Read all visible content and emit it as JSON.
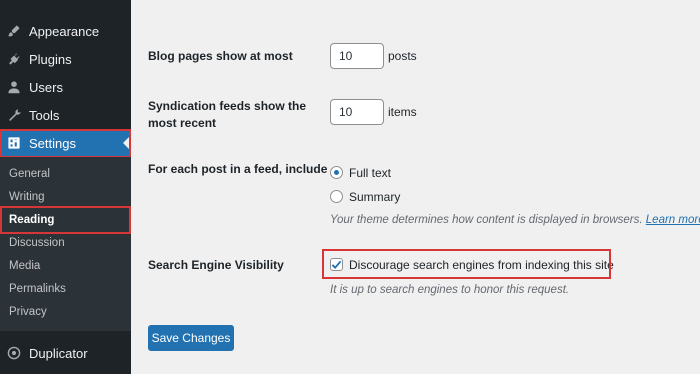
{
  "sidebar": {
    "menu": [
      {
        "label": "Appearance",
        "icon": "paintbrush-icon"
      },
      {
        "label": "Plugins",
        "icon": "plugin-icon"
      },
      {
        "label": "Users",
        "icon": "user-icon"
      },
      {
        "label": "Tools",
        "icon": "wrench-icon"
      },
      {
        "label": "Settings",
        "icon": "settings-icon"
      }
    ],
    "submenu": [
      "General",
      "Writing",
      "Reading",
      "Discussion",
      "Media",
      "Permalinks",
      "Privacy"
    ],
    "current_submenu": "Reading",
    "extra": {
      "label": "Duplicator",
      "icon": "duplicator-icon"
    }
  },
  "reading": {
    "blog_pages_label": "Blog pages show at most",
    "blog_pages_value": "10",
    "blog_pages_unit": "posts",
    "feeds_label_line1": "Syndication feeds show the",
    "feeds_label_line2": "most recent",
    "feeds_value": "10",
    "feeds_unit": "items",
    "feed_include_label": "For each post in a feed, include",
    "full_text_label": "Full text",
    "summary_label": "Summary",
    "selected_option": "Full text",
    "feed_description": "Your theme determines how content is displayed in browsers.",
    "learn_more_link": "Learn more a",
    "search_engine_label": "Search Engine Visibility",
    "discourage_label": "Discourage search engines from indexing this site",
    "discourage_checked": true,
    "search_engine_description": "It is up to search engines to honor this request.",
    "save_button": "Save Changes"
  },
  "colors": {
    "sidebar_bg": "#1d2327",
    "accent": "#2271b1",
    "highlight": "#d63638"
  }
}
